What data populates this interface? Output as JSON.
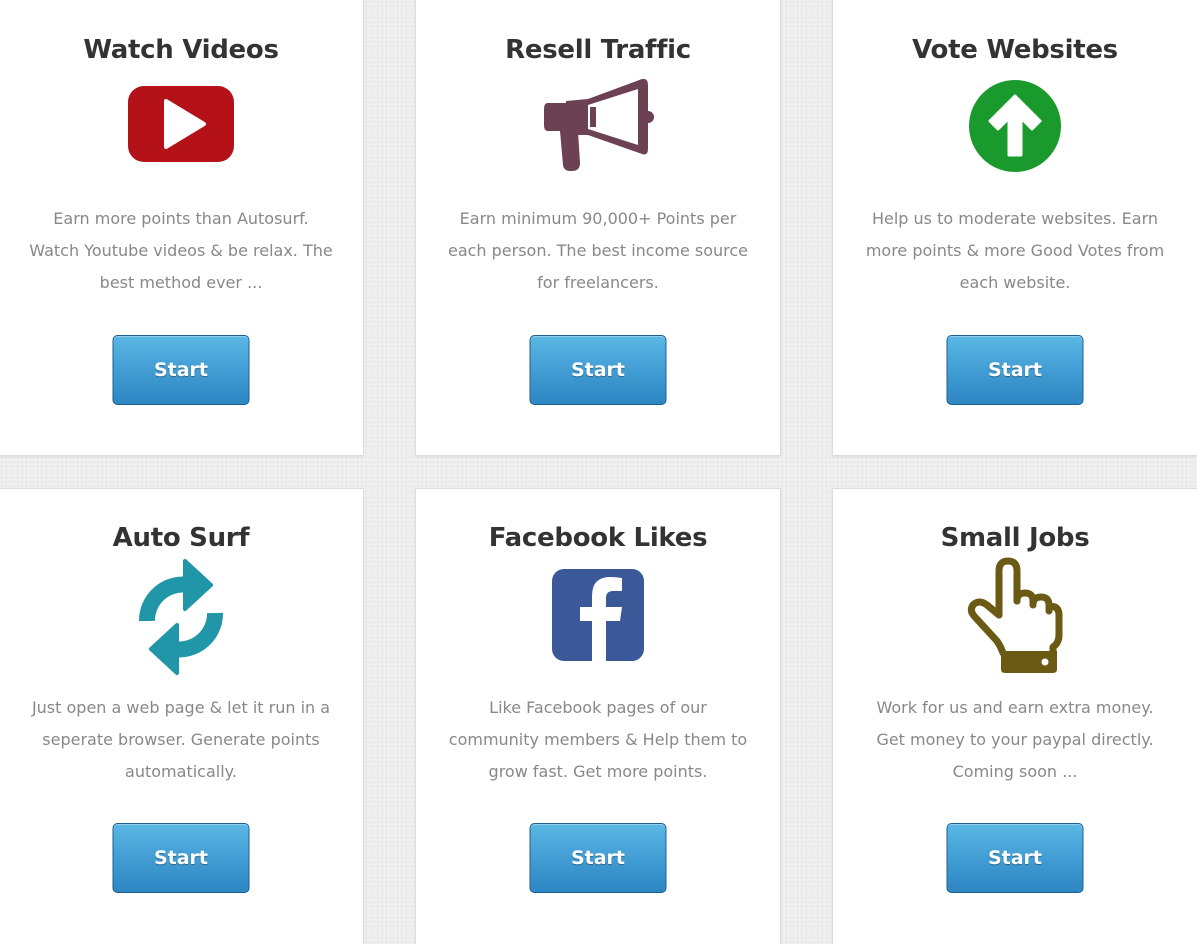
{
  "cards": [
    {
      "title": "Watch Videos",
      "icon": "youtube-icon",
      "description": "Earn more points than Autosurf. Watch Youtube videos & be relax. The best method ever ...",
      "button_label": "Start",
      "icon_color": "#b41218"
    },
    {
      "title": "Resell Traffic",
      "icon": "megaphone-icon",
      "description": "Earn minimum 90,000+ Points per each person. The best income source for freelancers.",
      "button_label": "Start",
      "icon_color": "#6b4153"
    },
    {
      "title": "Vote Websites",
      "icon": "arrow-up-circle-icon",
      "description": "Help us to moderate websites. Earn more points & more Good Votes from each website.",
      "button_label": "Start",
      "icon_color": "#1a9a2c"
    },
    {
      "title": "Auto Surf",
      "icon": "refresh-icon",
      "description": "Just open a web page & let it run in a seperate browser. Generate points automatically.",
      "button_label": "Start",
      "icon_color": "#2096a8"
    },
    {
      "title": "Facebook Likes",
      "icon": "facebook-icon",
      "description": "Like Facebook pages of our community members & Help them to grow fast. Get more points.",
      "button_label": "Start",
      "icon_color": "#3b5998"
    },
    {
      "title": "Small Jobs",
      "icon": "pointing-hand-icon",
      "description": "Work for us and earn extra money. Get money to your paypal directly. Coming soon ...",
      "button_label": "Start",
      "icon_color": "#6b5a14"
    }
  ]
}
